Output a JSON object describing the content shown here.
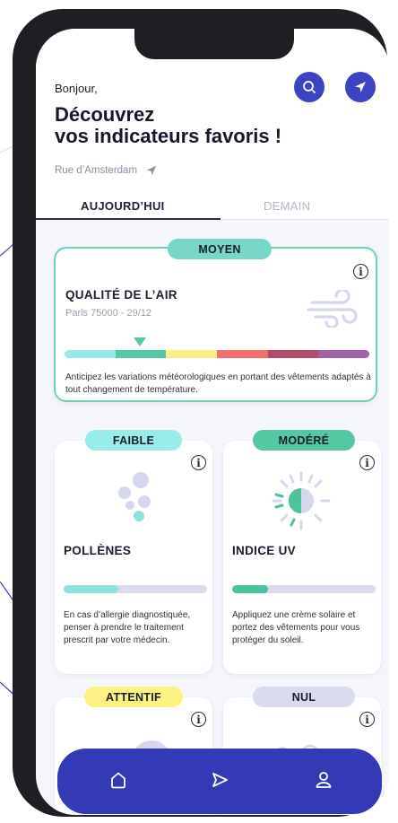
{
  "header": {
    "greeting": "Bonjour,",
    "title_line1": "Découvrez",
    "title_line2": "vos indicateurs favoris !",
    "address": "Rue d’Amsterdam",
    "search_icon": "search-icon",
    "location_icon": "location-arrow-icon"
  },
  "tabs": {
    "today": "AUJOURD’HUI",
    "tomorrow": "DEMAIN",
    "active": "today"
  },
  "air_quality": {
    "badge": "MOYEN",
    "badge_color": "#78d7c6",
    "border_color": "#6fcfb6",
    "title": "QUALITÉ DE L’AIR",
    "subtitle": "Paris 75000 - 29/12",
    "text": "Anticipez les variations météorologiques en portant des vêtements adaptés à tout changement de température.",
    "icon": "wind-icon",
    "scale_colors": [
      "#9ae8e6",
      "#55c7a6",
      "#f9ef86",
      "#f2716f",
      "#b34b68",
      "#9d63a6"
    ],
    "level_index": 1
  },
  "pollens": {
    "badge": "FAIBLE",
    "badge_color": "#98ede9",
    "title": "POLLÈNES",
    "text": "En cas d’allergie diagnostiquée, penser à prendre le traitement prescrit par votre médecin.",
    "icon": "pollen-icon",
    "level": 0.38,
    "fill_color": "#8fe2dc"
  },
  "uv": {
    "badge": "MODÉRÉ",
    "badge_color": "#56c7a3",
    "title": "INDICE UV",
    "text": "Appliquez une crème solaire et portez des vêtements pour vous protéger du soleil.",
    "icon": "sun-icon",
    "level": 0.25,
    "fill_color": "#4cc39d"
  },
  "card3": {
    "badge": "ATTENTIF",
    "badge_color": "#fbf281",
    "icon": "cloud-icon"
  },
  "card4": {
    "badge": "NUL",
    "badge_color": "#d9dbef",
    "icon": "wave-icon"
  },
  "info_label": "i",
  "nav": {
    "home": "home-icon",
    "send": "send-icon",
    "profile": "user-icon"
  }
}
